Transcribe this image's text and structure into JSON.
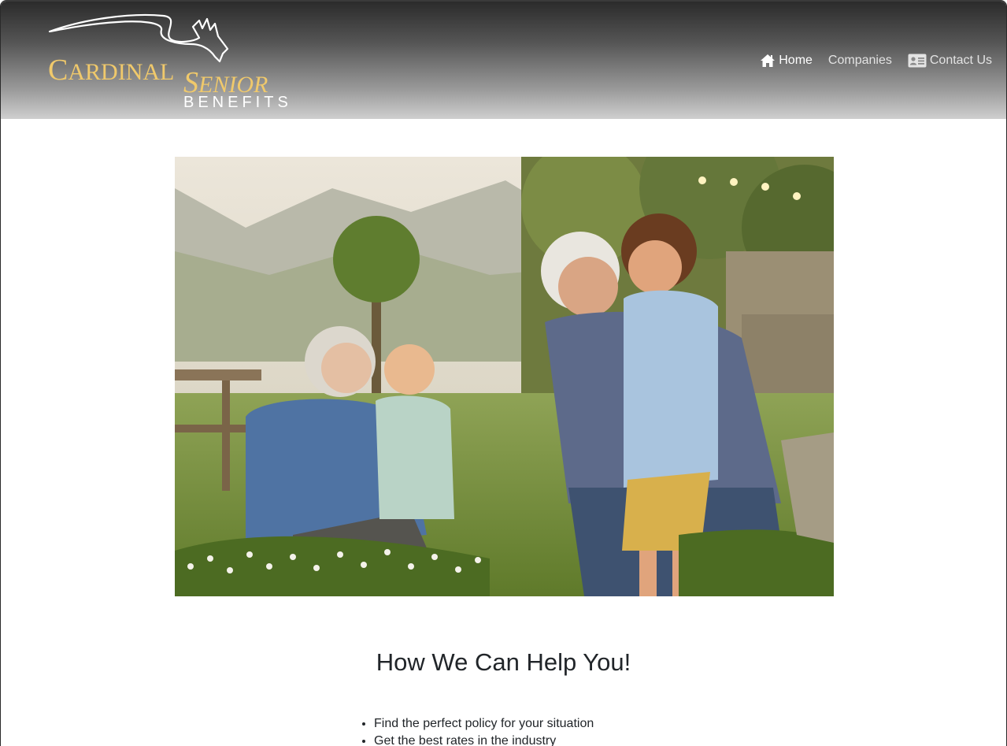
{
  "brand": {
    "word1_cap": "C",
    "word1_rest": "ARDINAL",
    "word2_cap": "S",
    "word2_rest": "ENIOR",
    "word3": "BENEFITS",
    "gold_color": "#f0c96b"
  },
  "nav": {
    "items": [
      {
        "label": "Home",
        "icon": "home-icon",
        "active": true
      },
      {
        "label": "Companies",
        "icon": null,
        "active": false
      },
      {
        "label": "Contact Us",
        "icon": "contact-card-icon",
        "active": false
      }
    ]
  },
  "hero": {
    "image": "grandparents-with-grandchildren-photo"
  },
  "main": {
    "title": "How We Can Help You!",
    "benefits": [
      "Find the perfect policy for your situation",
      "Get the best rates in the industry"
    ]
  }
}
